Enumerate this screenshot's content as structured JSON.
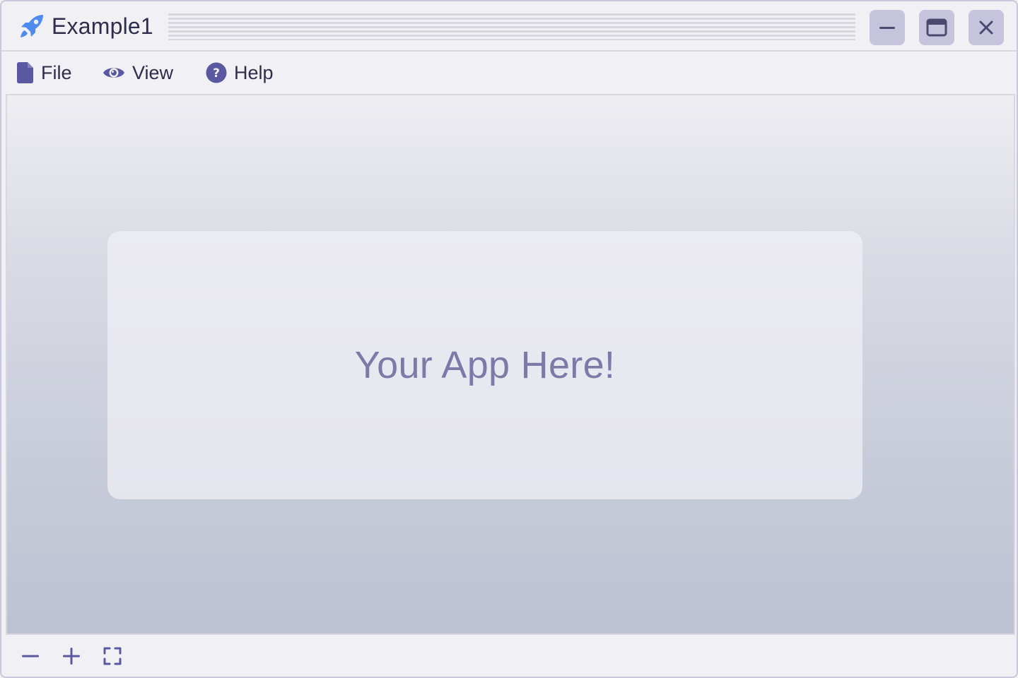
{
  "window": {
    "title": "Example1",
    "app_icon": "rocket-icon"
  },
  "window_controls": {
    "minimize_icon": "minimize-icon",
    "maximize_icon": "maximize-icon",
    "close_icon": "close-icon"
  },
  "menu": {
    "items": [
      {
        "label": "File",
        "icon": "file-icon"
      },
      {
        "label": "View",
        "icon": "eye-icon"
      },
      {
        "label": "Help",
        "icon": "help-icon"
      }
    ]
  },
  "content": {
    "placeholder_text": "Your App Here!"
  },
  "toolbar": {
    "items": [
      {
        "icon": "zoom-out-icon"
      },
      {
        "icon": "zoom-in-icon"
      },
      {
        "icon": "fit-screen-icon"
      }
    ]
  },
  "colors": {
    "accent": "#5a58a0",
    "rocket": "#4e8bf0",
    "window_button_bg": "#c6c4dd",
    "text_dark": "#2e2d4a",
    "placeholder_text": "#7d7aa8"
  }
}
